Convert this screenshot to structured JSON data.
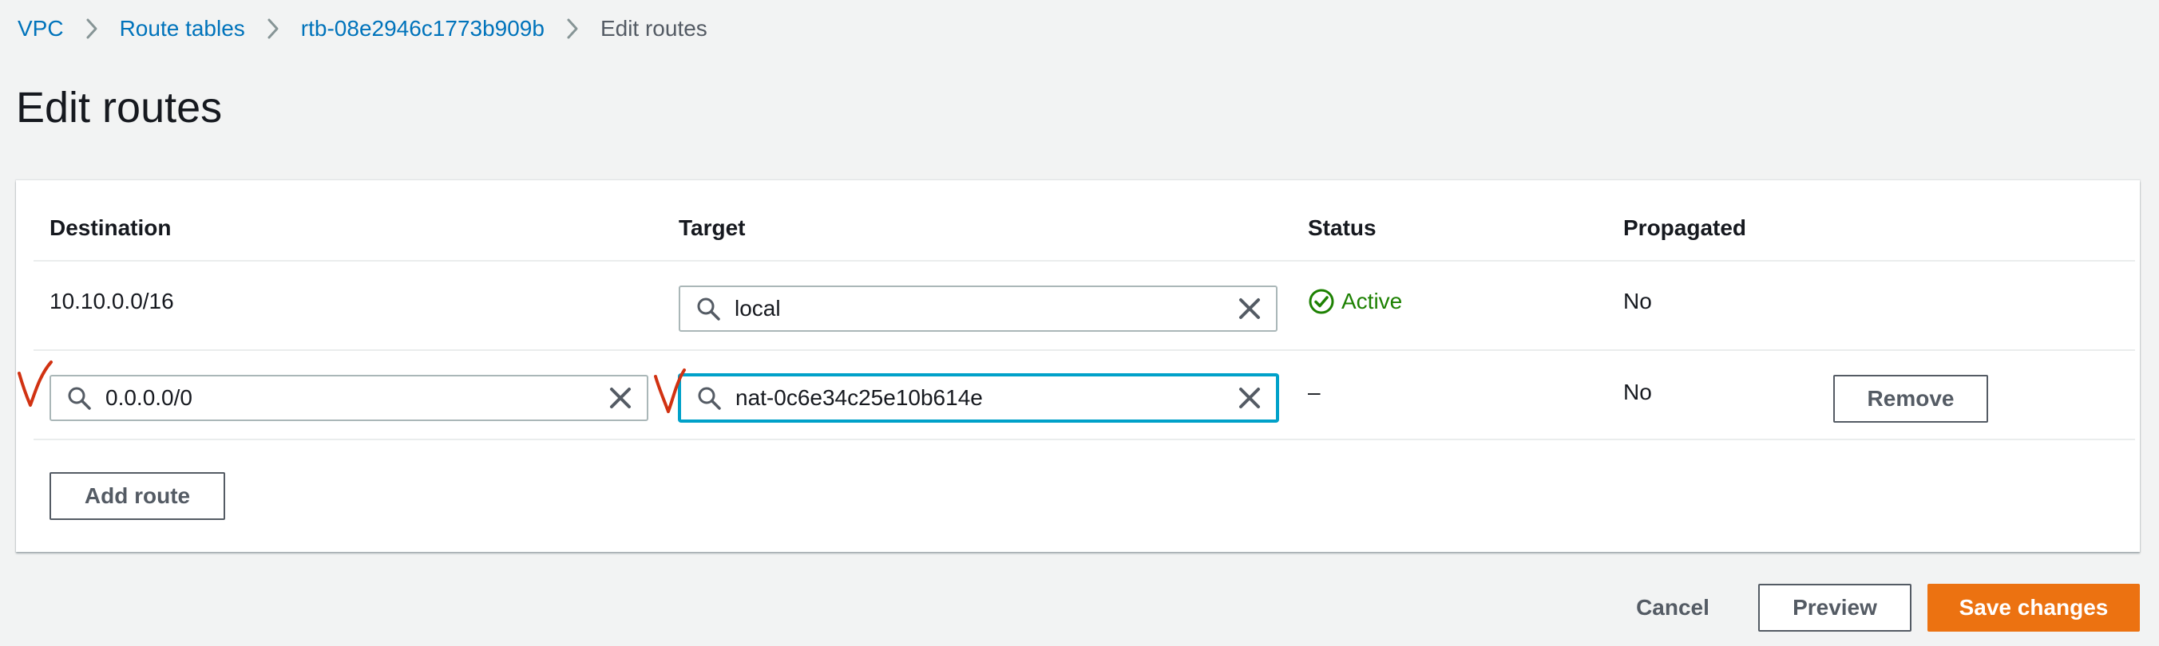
{
  "breadcrumb": {
    "items": [
      {
        "label": "VPC"
      },
      {
        "label": "Route tables"
      },
      {
        "label": "rtb-08e2946c1773b909b"
      }
    ],
    "current": "Edit routes"
  },
  "page": {
    "title": "Edit routes"
  },
  "table": {
    "headers": {
      "destination": "Destination",
      "target": "Target",
      "status": "Status",
      "propagated": "Propagated"
    },
    "rows": [
      {
        "destination": "10.10.0.0/16",
        "target": "local",
        "status": "Active",
        "propagated": "No"
      },
      {
        "destination": "0.0.0.0/0",
        "target": "nat-0c6e34c25e10b614e",
        "status": "–",
        "propagated": "No",
        "remove_label": "Remove"
      }
    ]
  },
  "actions": {
    "add_route": "Add route",
    "cancel": "Cancel",
    "preview": "Preview",
    "save": "Save changes"
  },
  "icons": {
    "breadcrumb_separator": "chevron-right-icon",
    "search": "search-icon",
    "clear": "close-icon",
    "status_ok": "check-circle-icon",
    "annotation": "hand-drawn-checkmark"
  },
  "colors": {
    "background": "#f2f3f3",
    "link": "#0073bb",
    "status_success": "#1d8102",
    "focus_border": "#00a1c9",
    "primary_button": "#ec7211",
    "annotation": "#d13212"
  }
}
